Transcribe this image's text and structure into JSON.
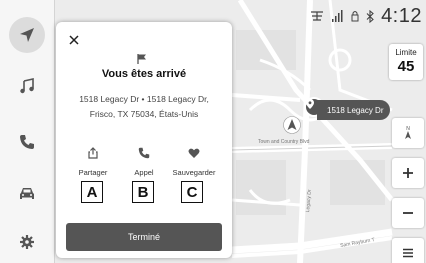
{
  "status": {
    "clock": "4:12"
  },
  "speed_limit": {
    "label": "Limite",
    "value": "45"
  },
  "map": {
    "destination_label": "1518 Legacy Dr",
    "streets": [
      "Town and Country Blvd",
      "Legacy Dr",
      "Sam Rayburn T"
    ],
    "compass_label": "N"
  },
  "dialog": {
    "title": "Vous êtes arrivé",
    "address_line1": "1518 Legacy Dr  •  1518 Legacy Dr,",
    "address_line2": "Frisco, TX 75034, États-Unis",
    "actions": [
      {
        "label": "Partager",
        "callout": "A"
      },
      {
        "label": "Appel",
        "callout": "B"
      },
      {
        "label": "Sauvegarder",
        "callout": "C"
      }
    ],
    "done_label": "Terminé"
  },
  "colors": {
    "panel_button": "#555555",
    "map_background": "#ededed",
    "road": "#ffffff"
  },
  "icons": [
    "navigation-arrow-icon",
    "music-note-icon",
    "phone-icon",
    "car-icon",
    "settings-icon",
    "close-icon",
    "flag-icon",
    "share-icon",
    "call-icon",
    "save-heart-icon",
    "signal-icon",
    "bluetooth-icon",
    "plus-icon",
    "minus-icon",
    "menu-icon"
  ]
}
